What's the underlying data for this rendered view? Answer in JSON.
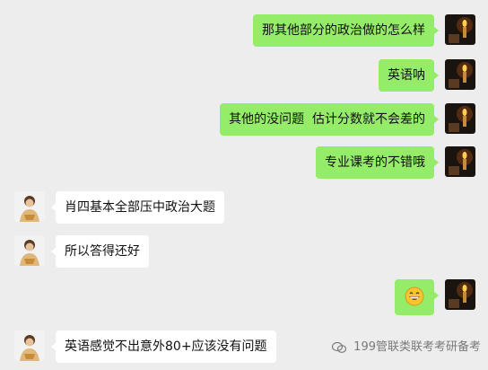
{
  "messages": [
    {
      "side": "right",
      "text": "那其他部分的政治做的怎么样"
    },
    {
      "side": "right",
      "text": "英语呐"
    },
    {
      "side": "right",
      "text": "其他的没问题  估计分数就不会差的"
    },
    {
      "side": "right",
      "text": "专业课考的不错哦"
    },
    {
      "side": "left",
      "text": "肖四基本全部压中政治大题"
    },
    {
      "side": "left",
      "text": "所以答得还好"
    },
    {
      "side": "right",
      "emoji": "grinning-face-emoji"
    },
    {
      "side": "left",
      "text": "英语感觉不出意外80+应该没有问题"
    }
  ],
  "watermark": {
    "text": "199管联类联考考研备考",
    "icon": "wechat-official-icon"
  },
  "colors": {
    "background": "#ededed",
    "sent_bubble": "#95ec69",
    "received_bubble": "#ffffff"
  }
}
